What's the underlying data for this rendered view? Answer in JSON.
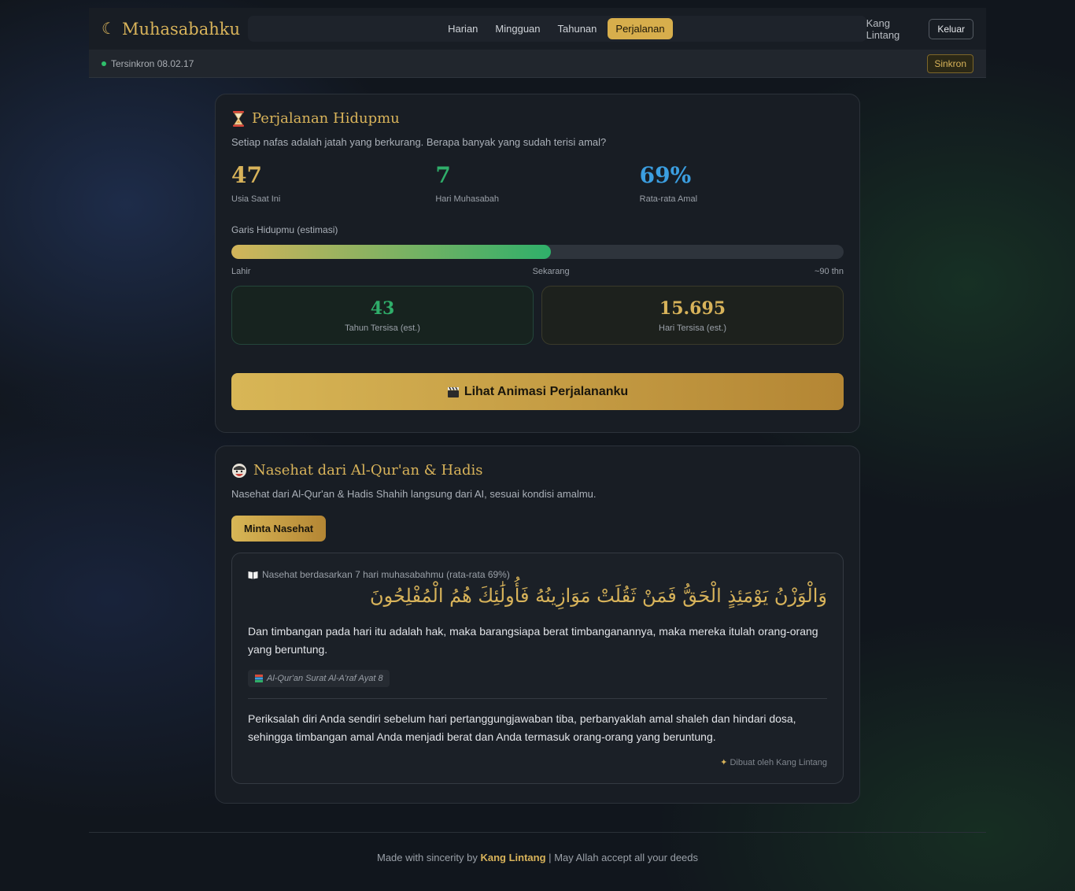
{
  "brand": {
    "name": "Muhasabahku",
    "icon": "crescent-moon-icon"
  },
  "nav": {
    "items": [
      {
        "label": "Harian",
        "active": false
      },
      {
        "label": "Mingguan",
        "active": false
      },
      {
        "label": "Tahunan",
        "active": false
      },
      {
        "label": "Perjalanan",
        "active": true
      }
    ]
  },
  "user": {
    "name": "Kang Lintang",
    "logout_label": "Keluar"
  },
  "sync": {
    "status": "Tersinkron 08.02.17",
    "button_label": "Sinkron",
    "status_color": "#2fbf6b"
  },
  "journey": {
    "icon": "hourglass-icon",
    "title": "Perjalanan Hidupmu",
    "subtitle": "Setiap nafas adalah jatah yang berkurang. Berapa banyak yang sudah terisi amal?",
    "stats": [
      {
        "value": "47",
        "label": "Usia Saat Ini",
        "color": "#d8b35a"
      },
      {
        "value": "7",
        "label": "Hari Muhasabah",
        "color": "#2fae6a"
      },
      {
        "value": "69%",
        "label": "Rata-rata Amal",
        "color": "#3b9ee0"
      }
    ],
    "lifeline": {
      "label": "Garis Hidupmu (estimasi)",
      "start_label": "Lahir",
      "now_label": "Sekarang",
      "end_label": "~90 thn",
      "progress": 0.522
    },
    "remaining": [
      {
        "value": "43",
        "label": "Tahun Tersisa (est.)",
        "color": "#2fae6a"
      },
      {
        "value": "15.695",
        "label": "Hari Tersisa (est.)",
        "color": "#d8b35a"
      }
    ],
    "animate_button": {
      "icon": "clapperboard-icon",
      "label": "Lihat Animasi Perjalananku"
    }
  },
  "advice": {
    "icon": "advisor-icon",
    "title": "Nasehat dari Al-Qur'an & Hadis",
    "subtitle": "Nasehat dari Al-Qur'an & Hadis Shahih langsung dari AI, sesuai kondisi amalmu.",
    "ask_button": "Minta Nasehat",
    "note_icon": "book-icon",
    "note": "Nasehat berdasarkan 7 hari muhasabahmu (rata-rata 69%)",
    "arabic": "وَالْوَزْنُ يَوْمَئِذٍ الْحَقُّ فَمَنْ ثَقُلَتْ مَوَازِينُهُ فَأُولَٰئِكَ هُمُ الْمُفْلِحُونَ",
    "translation": "Dan timbangan pada hari itu adalah hak, maka barangsiapa berat timbanganannya, maka mereka itulah orang-orang yang beruntung.",
    "source_icon": "books-icon",
    "source": "Al-Qur'an Surat Al-A'raf Ayat 8",
    "reflection": "Periksalah diri Anda sendiri sebelum hari pertanggungjawaban tiba, perbanyaklah amal shaleh dan hindari dosa, sehingga timbangan amal Anda menjadi berat dan Anda termasuk orang-orang yang beruntung.",
    "credit_icon": "sparkles-icon",
    "credit": "Dibuat oleh Kang Lintang"
  },
  "footer": {
    "prefix": "Made with sincerity by",
    "author": "Kang Lintang",
    "separator": "|",
    "suffix": "May Allah accept all your deeds"
  }
}
